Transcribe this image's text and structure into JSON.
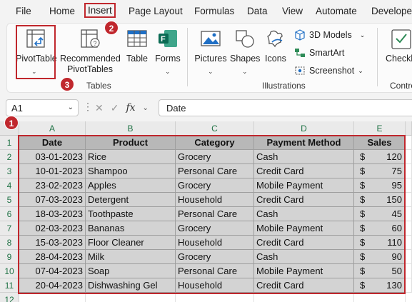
{
  "menu": {
    "tabs": [
      "File",
      "Home",
      "Insert",
      "Page Layout",
      "Formulas",
      "Data",
      "View",
      "Automate",
      "Develope"
    ],
    "active": "Insert"
  },
  "ribbon": {
    "pivottable_label": "PivotTable",
    "recommended_line1": "Recommended",
    "recommended_line2": "PivotTables",
    "table_label": "Table",
    "forms_label": "Forms",
    "pictures_label": "Pictures",
    "shapes_label": "Shapes",
    "icons_label": "Icons",
    "models_label": "3D Models",
    "smartart_label": "SmartArt",
    "screenshot_label": "Screenshot",
    "checkbox_label": "Checkb",
    "tables_group": "Tables",
    "illustrations_group": "Illustrations",
    "controls_group": "Contro"
  },
  "badges": {
    "one": "1",
    "two": "2",
    "three": "3"
  },
  "formula_bar": {
    "name_box": "A1",
    "fx": "fx",
    "formula": "Date"
  },
  "sheet": {
    "columns": [
      "A",
      "B",
      "C",
      "D",
      "E"
    ],
    "rows": [
      "1",
      "2",
      "3",
      "4",
      "5",
      "6",
      "7",
      "8",
      "9",
      "10",
      "11",
      "12"
    ],
    "headers": [
      "Date",
      "Product",
      "Category",
      "Payment Method",
      "Sales"
    ],
    "currency": "$",
    "data": [
      [
        "03-01-2023",
        "Rice",
        "Grocery",
        "Cash",
        "120"
      ],
      [
        "10-01-2023",
        "Shampoo",
        "Personal Care",
        "Credit Card",
        "75"
      ],
      [
        "23-02-2023",
        "Apples",
        "Grocery",
        "Mobile Payment",
        "95"
      ],
      [
        "07-03-2023",
        "Detergent",
        "Household",
        "Credit Card",
        "150"
      ],
      [
        "18-03-2023",
        "Toothpaste",
        "Personal Care",
        "Cash",
        "45"
      ],
      [
        "02-03-2023",
        "Bananas",
        "Grocery",
        "Mobile Payment",
        "60"
      ],
      [
        "15-03-2023",
        "Floor Cleaner",
        "Household",
        "Credit Card",
        "110"
      ],
      [
        "28-04-2023",
        "Milk",
        "Grocery",
        "Cash",
        "90"
      ],
      [
        "07-04-2023",
        "Soap",
        "Personal Care",
        "Mobile Payment",
        "50"
      ],
      [
        "20-04-2023",
        "Dishwashing Gel",
        "Household",
        "Credit Card",
        "130"
      ]
    ]
  },
  "colors": {
    "accent_red": "#c0272d",
    "excel_green": "#217346",
    "header_fill": "#b8b8b8",
    "cell_fill": "#d3d3d3"
  }
}
